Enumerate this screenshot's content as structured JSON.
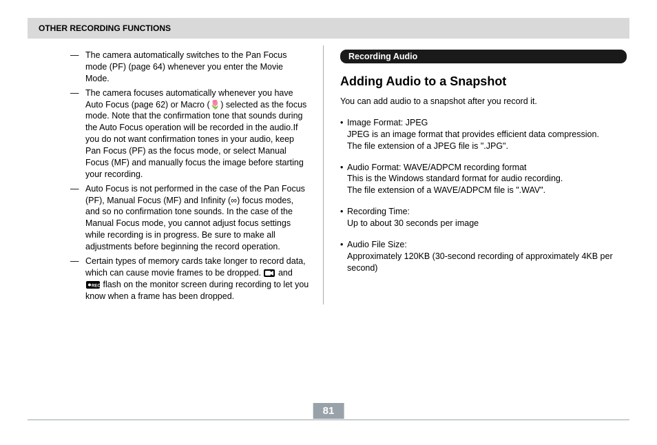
{
  "header": "OTHER RECORDING FUNCTIONS",
  "page_number": "81",
  "left": {
    "items": [
      "The camera automatically switches to the Pan Focus mode (PF) (page 64) whenever you enter the Movie Mode.",
      "The camera focuses automatically whenever you have Auto Focus (page 62) or Macro (🌷) selected as the focus mode. Note that the confirmation tone that sounds during the Auto Focus operation will be recorded in the audio.If you do not want confirmation tones in your audio, keep Pan Focus (PF) as the focus mode, or select Manual Focus (MF) and manually focus the image before starting your recording.",
      "Auto Focus is not performed in the case of the Pan Focus (PF), Manual Focus (MF) and Infinity (∞) focus modes, and so no confirmation tone sounds. In the case of the Manual Focus mode, you cannot adjust focus settings while recording is in progress. Be sure to make all adjustments before beginning the record operation."
    ],
    "item4_pre": "Certain types of memory cards take longer to record data, which can cause movie frames to be dropped. ",
    "item4_mid": " and ",
    "item4_post": " flash on the monitor screen during recording to let you know when a frame has been dropped."
  },
  "right": {
    "section_title": "Recording Audio",
    "subheading": "Adding Audio to a Snapshot",
    "intro": "You can add audio to a snapshot after you record it.",
    "specs": [
      {
        "title": "Image Format: JPEG",
        "lines": [
          "JPEG is an image format that provides efficient data compression.",
          "The file extension of a JPEG file is \".JPG\"."
        ]
      },
      {
        "title": "Audio Format: WAVE/ADPCM recording format",
        "lines": [
          "This is the Windows standard format for audio recording.",
          "The file extension of a WAVE/ADPCM file is \".WAV\"."
        ]
      },
      {
        "title": "Recording Time:",
        "lines": [
          "Up to about 30 seconds per image"
        ]
      },
      {
        "title": "Audio File Size:",
        "lines": [
          "Approximately 120KB (30-second recording of approximately 4KB per second)"
        ]
      }
    ]
  }
}
